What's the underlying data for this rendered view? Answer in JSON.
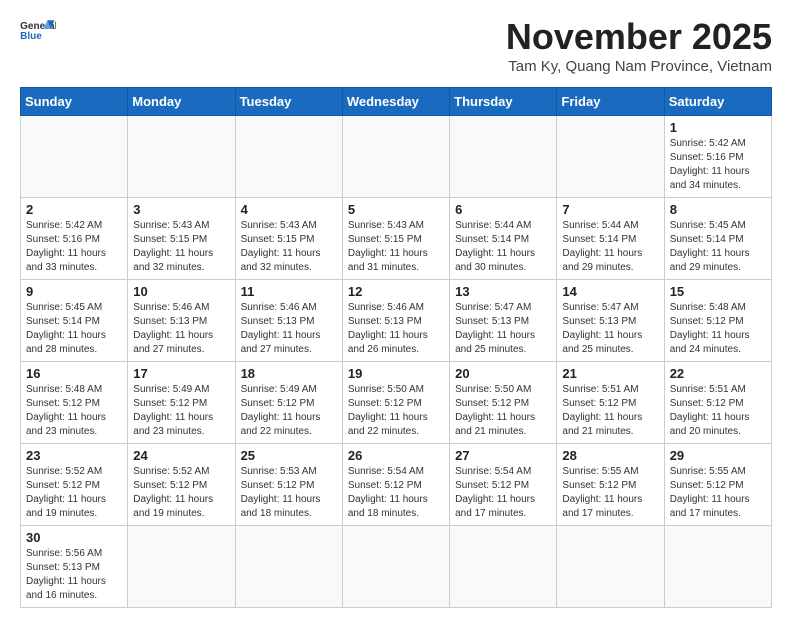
{
  "header": {
    "logo_general": "General",
    "logo_blue": "Blue",
    "month_title": "November 2025",
    "location": "Tam Ky, Quang Nam Province, Vietnam"
  },
  "weekdays": [
    "Sunday",
    "Monday",
    "Tuesday",
    "Wednesday",
    "Thursday",
    "Friday",
    "Saturday"
  ],
  "weeks": [
    [
      {
        "day": "",
        "info": ""
      },
      {
        "day": "",
        "info": ""
      },
      {
        "day": "",
        "info": ""
      },
      {
        "day": "",
        "info": ""
      },
      {
        "day": "",
        "info": ""
      },
      {
        "day": "",
        "info": ""
      },
      {
        "day": "1",
        "info": "Sunrise: 5:42 AM\nSunset: 5:16 PM\nDaylight: 11 hours\nand 34 minutes."
      }
    ],
    [
      {
        "day": "2",
        "info": "Sunrise: 5:42 AM\nSunset: 5:16 PM\nDaylight: 11 hours\nand 33 minutes."
      },
      {
        "day": "3",
        "info": "Sunrise: 5:43 AM\nSunset: 5:15 PM\nDaylight: 11 hours\nand 32 minutes."
      },
      {
        "day": "4",
        "info": "Sunrise: 5:43 AM\nSunset: 5:15 PM\nDaylight: 11 hours\nand 32 minutes."
      },
      {
        "day": "5",
        "info": "Sunrise: 5:43 AM\nSunset: 5:15 PM\nDaylight: 11 hours\nand 31 minutes."
      },
      {
        "day": "6",
        "info": "Sunrise: 5:44 AM\nSunset: 5:14 PM\nDaylight: 11 hours\nand 30 minutes."
      },
      {
        "day": "7",
        "info": "Sunrise: 5:44 AM\nSunset: 5:14 PM\nDaylight: 11 hours\nand 29 minutes."
      },
      {
        "day": "8",
        "info": "Sunrise: 5:45 AM\nSunset: 5:14 PM\nDaylight: 11 hours\nand 29 minutes."
      }
    ],
    [
      {
        "day": "9",
        "info": "Sunrise: 5:45 AM\nSunset: 5:14 PM\nDaylight: 11 hours\nand 28 minutes."
      },
      {
        "day": "10",
        "info": "Sunrise: 5:46 AM\nSunset: 5:13 PM\nDaylight: 11 hours\nand 27 minutes."
      },
      {
        "day": "11",
        "info": "Sunrise: 5:46 AM\nSunset: 5:13 PM\nDaylight: 11 hours\nand 27 minutes."
      },
      {
        "day": "12",
        "info": "Sunrise: 5:46 AM\nSunset: 5:13 PM\nDaylight: 11 hours\nand 26 minutes."
      },
      {
        "day": "13",
        "info": "Sunrise: 5:47 AM\nSunset: 5:13 PM\nDaylight: 11 hours\nand 25 minutes."
      },
      {
        "day": "14",
        "info": "Sunrise: 5:47 AM\nSunset: 5:13 PM\nDaylight: 11 hours\nand 25 minutes."
      },
      {
        "day": "15",
        "info": "Sunrise: 5:48 AM\nSunset: 5:12 PM\nDaylight: 11 hours\nand 24 minutes."
      }
    ],
    [
      {
        "day": "16",
        "info": "Sunrise: 5:48 AM\nSunset: 5:12 PM\nDaylight: 11 hours\nand 23 minutes."
      },
      {
        "day": "17",
        "info": "Sunrise: 5:49 AM\nSunset: 5:12 PM\nDaylight: 11 hours\nand 23 minutes."
      },
      {
        "day": "18",
        "info": "Sunrise: 5:49 AM\nSunset: 5:12 PM\nDaylight: 11 hours\nand 22 minutes."
      },
      {
        "day": "19",
        "info": "Sunrise: 5:50 AM\nSunset: 5:12 PM\nDaylight: 11 hours\nand 22 minutes."
      },
      {
        "day": "20",
        "info": "Sunrise: 5:50 AM\nSunset: 5:12 PM\nDaylight: 11 hours\nand 21 minutes."
      },
      {
        "day": "21",
        "info": "Sunrise: 5:51 AM\nSunset: 5:12 PM\nDaylight: 11 hours\nand 21 minutes."
      },
      {
        "day": "22",
        "info": "Sunrise: 5:51 AM\nSunset: 5:12 PM\nDaylight: 11 hours\nand 20 minutes."
      }
    ],
    [
      {
        "day": "23",
        "info": "Sunrise: 5:52 AM\nSunset: 5:12 PM\nDaylight: 11 hours\nand 19 minutes."
      },
      {
        "day": "24",
        "info": "Sunrise: 5:52 AM\nSunset: 5:12 PM\nDaylight: 11 hours\nand 19 minutes."
      },
      {
        "day": "25",
        "info": "Sunrise: 5:53 AM\nSunset: 5:12 PM\nDaylight: 11 hours\nand 18 minutes."
      },
      {
        "day": "26",
        "info": "Sunrise: 5:54 AM\nSunset: 5:12 PM\nDaylight: 11 hours\nand 18 minutes."
      },
      {
        "day": "27",
        "info": "Sunrise: 5:54 AM\nSunset: 5:12 PM\nDaylight: 11 hours\nand 17 minutes."
      },
      {
        "day": "28",
        "info": "Sunrise: 5:55 AM\nSunset: 5:12 PM\nDaylight: 11 hours\nand 17 minutes."
      },
      {
        "day": "29",
        "info": "Sunrise: 5:55 AM\nSunset: 5:12 PM\nDaylight: 11 hours\nand 17 minutes."
      }
    ],
    [
      {
        "day": "30",
        "info": "Sunrise: 5:56 AM\nSunset: 5:13 PM\nDaylight: 11 hours\nand 16 minutes."
      },
      {
        "day": "",
        "info": ""
      },
      {
        "day": "",
        "info": ""
      },
      {
        "day": "",
        "info": ""
      },
      {
        "day": "",
        "info": ""
      },
      {
        "day": "",
        "info": ""
      },
      {
        "day": "",
        "info": ""
      }
    ]
  ]
}
